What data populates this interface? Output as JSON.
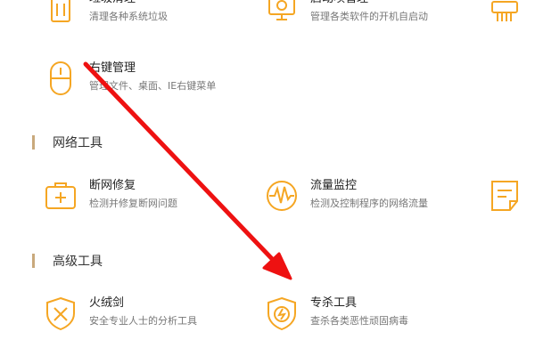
{
  "colors": {
    "accent": "#f5a623",
    "annotation_arrow": "#ee1111"
  },
  "tools_top": [
    {
      "title": "垃圾清理",
      "desc": "清理各种系统垃圾",
      "icon": "trash-icon"
    },
    {
      "title": "启动项管理",
      "desc": "管理各类软件的开机自启动",
      "icon": "startup-monitor-icon"
    },
    {
      "title": "",
      "desc": "",
      "icon": "shredder-icon"
    }
  ],
  "tool_right_click": {
    "title": "右键管理",
    "desc": "管理文件、桌面、IE右键菜单",
    "icon": "mouse-icon"
  },
  "sections": {
    "network": "网络工具",
    "advanced": "高级工具"
  },
  "network_tools": [
    {
      "title": "断网修复",
      "desc": "检测并修复断网问题",
      "icon": "first-aid-kit-icon"
    },
    {
      "title": "流量监控",
      "desc": "检测及控制程序的网络流量",
      "icon": "traffic-monitor-icon"
    },
    {
      "title": "",
      "desc": "",
      "icon": "notepad-icon"
    }
  ],
  "advanced_tools": [
    {
      "title": "火绒剑",
      "desc": "安全专业人士的分析工具",
      "icon": "shield-sword-icon"
    },
    {
      "title": "专杀工具",
      "desc": "查杀各类恶性顽固病毒",
      "icon": "shield-bolt-icon"
    }
  ]
}
